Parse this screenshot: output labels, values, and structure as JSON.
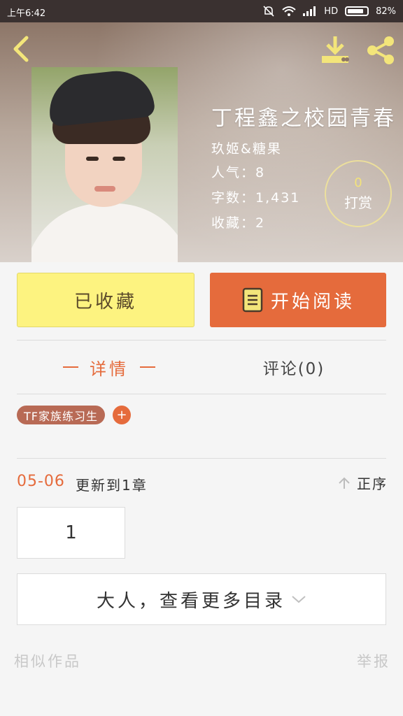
{
  "status_bar": {
    "time": "上午6:42",
    "network": "HD",
    "battery": "82%"
  },
  "header": {
    "title": "丁程鑫之校园青春",
    "author": "玖姬&糖果",
    "popularity": "人气：8",
    "word_count": "字数：1,431",
    "favorites": "收藏：2",
    "reward_count": "0",
    "reward_label": "打赏"
  },
  "actions": {
    "favorited_label": "已收藏",
    "read_label": "开始阅读"
  },
  "tabs": {
    "detail": "详情",
    "comments": "评论(0)"
  },
  "tags": [
    "TF家族练习生"
  ],
  "tag_add": "+",
  "updates": {
    "date": "05-06",
    "text": "更新到1章",
    "sort_label": "正序",
    "chapters": [
      "1"
    ],
    "more_label": "大人，查看更多目录"
  },
  "footer": {
    "similar": "相似作品",
    "report": "举报"
  },
  "colors": {
    "accent": "#e56b3c",
    "favorite_bg": "#fdf380",
    "tag_bg": "#b86a55",
    "reward_ring": "#f4e796"
  }
}
